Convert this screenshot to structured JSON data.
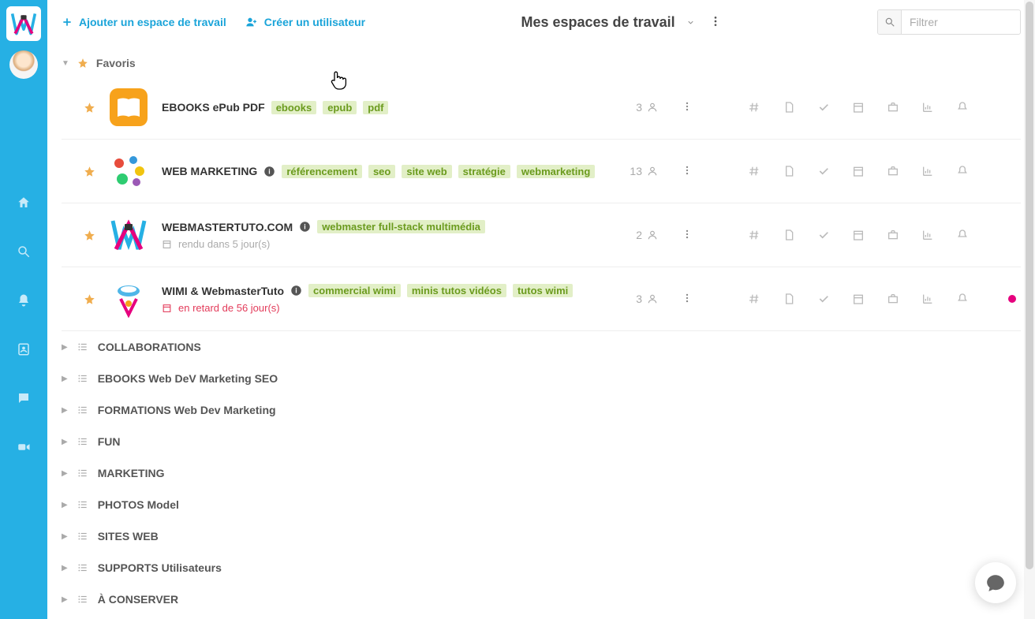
{
  "topbar": {
    "add_workspace": "Ajouter un espace de travail",
    "create_user": "Créer un utilisateur",
    "dropdown_title": "Mes espaces de travail",
    "search_placeholder": "Filtrer"
  },
  "sections": {
    "favorites_label": "Favoris"
  },
  "workspaces": [
    {
      "name": "EBOOKS ePub PDF",
      "tags": [
        "ebooks",
        "epub",
        "pdf"
      ],
      "members": "3",
      "info": false,
      "sub": null,
      "dot": false,
      "icon": "ibooks"
    },
    {
      "name": "WEB MARKETING",
      "tags": [
        "référencement",
        "seo",
        "site web",
        "stratégie",
        "webmarketing"
      ],
      "members": "13",
      "info": true,
      "sub": null,
      "dot": false,
      "icon": "marketing"
    },
    {
      "name": "WEBMASTERTUTO.COM",
      "tags": [
        "webmaster full-stack multimédia"
      ],
      "members": "2",
      "info": true,
      "sub": {
        "text": "rendu dans 5 jour(s)",
        "type": "grey"
      },
      "dot": false,
      "icon": "wmt"
    },
    {
      "name": "WIMI & WebmasterTuto",
      "tags": [
        "commercial wimi",
        "minis tutos vidéos",
        "tutos wimi"
      ],
      "members": "3",
      "info": true,
      "sub": {
        "text": "en retard de 56 jour(s)",
        "type": "red"
      },
      "dot": true,
      "icon": "wimi"
    }
  ],
  "categories": [
    "COLLABORATIONS",
    "EBOOKS Web DeV Marketing SEO",
    "FORMATIONS Web Dev Marketing",
    "FUN",
    "MARKETING",
    "PHOTOS Model",
    "SITES WEB",
    "SUPPORTS Utilisateurs",
    "À CONSERVER"
  ]
}
